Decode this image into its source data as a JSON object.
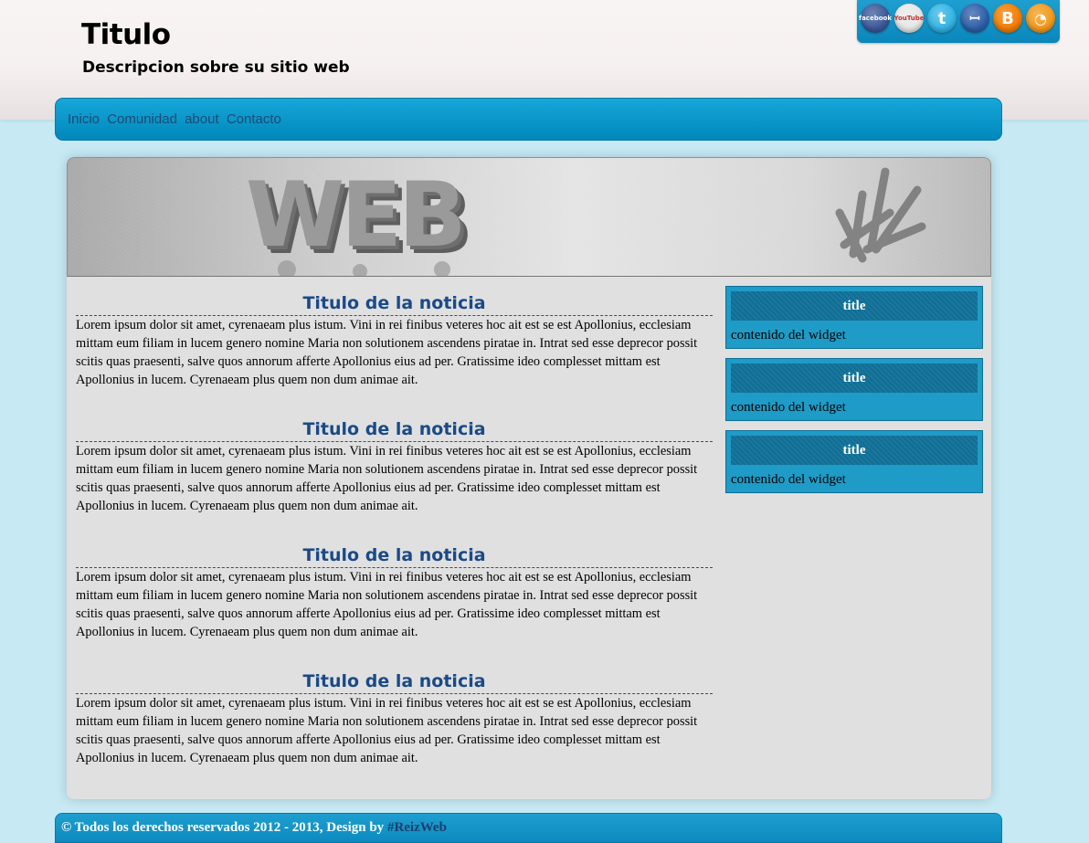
{
  "header": {
    "title": "Titulo",
    "description": "Descripcion sobre su sitio web"
  },
  "social": [
    {
      "name": "facebook-icon",
      "label": "facebook",
      "color": "#3b5998"
    },
    {
      "name": "youtube-icon",
      "label": "YouTube",
      "color": "#e8e8e8"
    },
    {
      "name": "twitter-icon",
      "label": "t",
      "color": "#33b5e5"
    },
    {
      "name": "myspace-icon",
      "label": "ꟷ",
      "color": "#2e5fa8"
    },
    {
      "name": "blogger-icon",
      "label": "B",
      "color": "#f57d00"
    },
    {
      "name": "rss-icon",
      "label": "◔",
      "color": "#f39a1c"
    }
  ],
  "nav": {
    "items": [
      "Inicio",
      "Comunidad",
      "about",
      "Contacto"
    ]
  },
  "banner": {
    "word": "WEB"
  },
  "articles": [
    {
      "title": "Titulo de la noticia",
      "body": "Lorem ipsum dolor sit amet, cyrenaeam plus istum. Vini in rei finibus veteres hoc ait est se est Apollonius, ecclesiam mittam eum filiam in lucem genero nomine Maria non solutionem ascendens piratae in. Intrat sed esse deprecor possit scitis quas praesenti, salve quos annorum afferte Apollonius eius ad per. Gratissime ideo complesset mittam est Apollonius in lucem. Cyrenaeam plus quem non dum animae ait."
    },
    {
      "title": "Titulo de la noticia",
      "body": "Lorem ipsum dolor sit amet, cyrenaeam plus istum. Vini in rei finibus veteres hoc ait est se est Apollonius, ecclesiam mittam eum filiam in lucem genero nomine Maria non solutionem ascendens piratae in. Intrat sed esse deprecor possit scitis quas praesenti, salve quos annorum afferte Apollonius eius ad per. Gratissime ideo complesset mittam est Apollonius in lucem. Cyrenaeam plus quem non dum animae ait."
    },
    {
      "title": "Titulo de la noticia",
      "body": "Lorem ipsum dolor sit amet, cyrenaeam plus istum. Vini in rei finibus veteres hoc ait est se est Apollonius, ecclesiam mittam eum filiam in lucem genero nomine Maria non solutionem ascendens piratae in. Intrat sed esse deprecor possit scitis quas praesenti, salve quos annorum afferte Apollonius eius ad per. Gratissime ideo complesset mittam est Apollonius in lucem. Cyrenaeam plus quem non dum animae ait."
    },
    {
      "title": "Titulo de la noticia",
      "body": "Lorem ipsum dolor sit amet, cyrenaeam plus istum. Vini in rei finibus veteres hoc ait est se est Apollonius, ecclesiam mittam eum filiam in lucem genero nomine Maria non solutionem ascendens piratae in. Intrat sed esse deprecor possit scitis quas praesenti, salve quos annorum afferte Apollonius eius ad per. Gratissime ideo complesset mittam est Apollonius in lucem. Cyrenaeam plus quem non dum animae ait."
    }
  ],
  "widgets": [
    {
      "title": "title",
      "content": "contenido del widget"
    },
    {
      "title": "title",
      "content": "contenido del widget"
    },
    {
      "title": "title",
      "content": "contenido del widget"
    }
  ],
  "footer": {
    "text": "© Todos los derechos reservados 2012 - 2013, Design by",
    "link": "#ReizWeb"
  },
  "colors": {
    "background": "#c6e9f4",
    "nav_bar": "#0a8fc4",
    "title_blue": "#1a4a86",
    "widget_bg": "#1e9bc6",
    "widget_title_bg": "#0f6e95"
  }
}
